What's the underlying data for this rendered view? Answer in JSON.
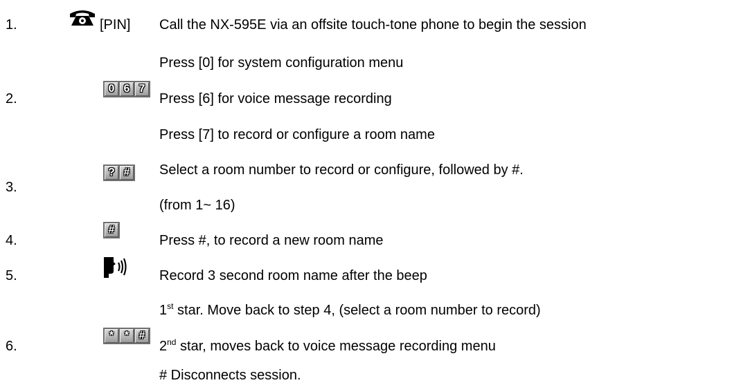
{
  "steps": [
    {
      "number": "1.",
      "icon": "phone-icon",
      "icon_label": "[PIN]",
      "lines": [
        "Call the NX-595E via an offsite touch-tone phone to begin the session"
      ]
    },
    {
      "number": "2.",
      "keys": [
        "0",
        "6",
        "7"
      ],
      "lines": [
        "Press [0] for system configuration menu",
        "Press [6] for voice message recording",
        "Press [7] to record or configure a room name"
      ]
    },
    {
      "number": "3.",
      "keys": [
        "?",
        "#"
      ],
      "lines": [
        "Select a room number to record or configure, followed by #.",
        "(from 1~ 16)"
      ]
    },
    {
      "number": "4.",
      "keys": [
        "#"
      ],
      "lines": [
        "Press #, to record a new room name"
      ]
    },
    {
      "number": "5.",
      "icon": "speaking-head-icon",
      "lines": [
        "Record 3 second room name after the beep"
      ]
    },
    {
      "number": "6.",
      "keys": [
        "*",
        "*",
        "#"
      ],
      "lines": [
        {
          "pre": "1",
          "sup": "st",
          "post": " star. Move back to step 4, (select a room number to record)"
        },
        {
          "pre": "2",
          "sup": "nd",
          "post": " star, moves back to voice message recording menu"
        },
        "# Disconnects session."
      ]
    }
  ]
}
